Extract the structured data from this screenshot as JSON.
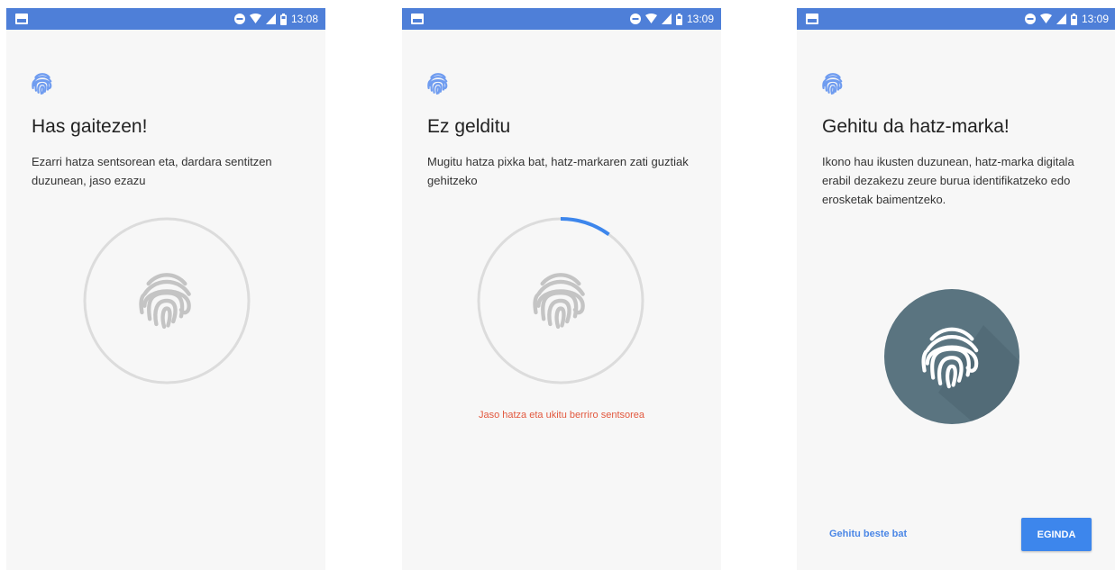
{
  "screens": [
    {
      "time": "13:08",
      "title": "Has gaitezen!",
      "description": "Ezarri hatza sentsorean eta, dardara sentitzen duzunean, jaso ezazu"
    },
    {
      "time": "13:09",
      "title": "Ez gelditu",
      "description": "Mugitu hatza pixka bat, hatz-markaren zati guztiak gehitzeko",
      "error_message": "Jaso hatza eta ukitu berriro sentsorea",
      "progress": 0.1
    },
    {
      "time": "13:09",
      "title": "Gehitu da hatz-marka!",
      "description": "Ikono hau ikusten duzunean, hatz-marka digitala erabil dezakezu zeure burua identifikatzeko edo erosketak baimentzeko.",
      "add_another_label": "Gehitu beste bat",
      "done_label": "EGINDA"
    }
  ],
  "colors": {
    "status_bar": "#4e7fd8",
    "accent": "#3d86ec",
    "error": "#e2583e",
    "success_circle": "#5a7480"
  },
  "icons": [
    "fingerprint-icon",
    "notification-icon",
    "dnd-icon",
    "wifi-icon",
    "signal-icon",
    "battery-icon"
  ]
}
